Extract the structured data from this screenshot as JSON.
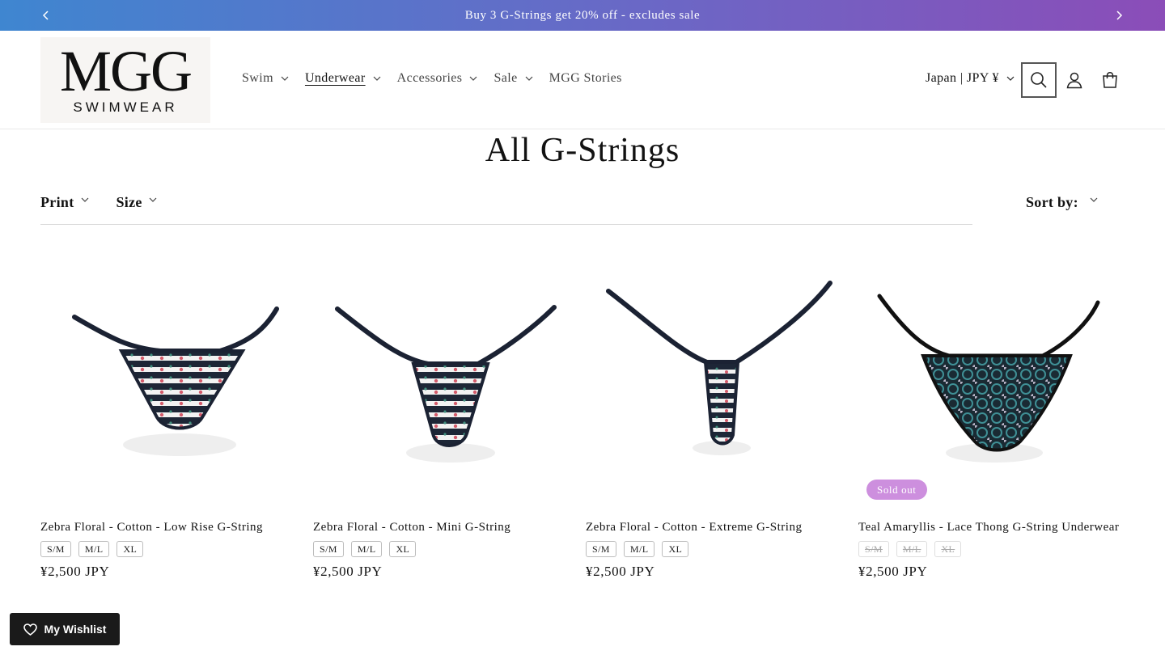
{
  "announcement": {
    "text": "Buy 3 G-Strings get 20% off - excludes sale"
  },
  "logo": {
    "line1": "MGG",
    "line2": "SWIMWEAR"
  },
  "nav": [
    {
      "label": "Swim",
      "dropdown": true,
      "active": false
    },
    {
      "label": "Underwear",
      "dropdown": true,
      "active": true
    },
    {
      "label": "Accessories",
      "dropdown": true,
      "active": false
    },
    {
      "label": "Sale",
      "dropdown": true,
      "active": false
    },
    {
      "label": "MGG Stories",
      "dropdown": false,
      "active": false
    }
  ],
  "locale": {
    "label": "Japan | JPY ¥"
  },
  "icons": {
    "search": "search-icon",
    "account": "account-icon",
    "cart": "cart-icon"
  },
  "page_title": "All G-Strings",
  "filters": {
    "print": "Print",
    "size": "Size",
    "sort": "Sort by:"
  },
  "products": [
    {
      "name": "Zebra Floral - Cotton - Low Rise G-String",
      "sizes": [
        "S/M",
        "M/L",
        "XL"
      ],
      "available": true,
      "price": "¥2,500 JPY",
      "badge": ""
    },
    {
      "name": "Zebra Floral - Cotton - Mini G-String",
      "sizes": [
        "S/M",
        "M/L",
        "XL"
      ],
      "available": true,
      "price": "¥2,500 JPY",
      "badge": ""
    },
    {
      "name": "Zebra Floral - Cotton - Extreme G-String",
      "sizes": [
        "S/M",
        "M/L",
        "XL"
      ],
      "available": true,
      "price": "¥2,500 JPY",
      "badge": ""
    },
    {
      "name": "Teal Amaryllis - Lace Thong G-String Underwear",
      "sizes": [
        "S/M",
        "M/L",
        "XL"
      ],
      "available": false,
      "price": "¥2,500 JPY",
      "badge": "Sold out"
    }
  ],
  "wishlist": {
    "label": "My Wishlist"
  },
  "colors": {
    "accent_badge": "#cd8fde",
    "banner_start": "#3f86d0",
    "banner_end": "#8b4db8"
  }
}
